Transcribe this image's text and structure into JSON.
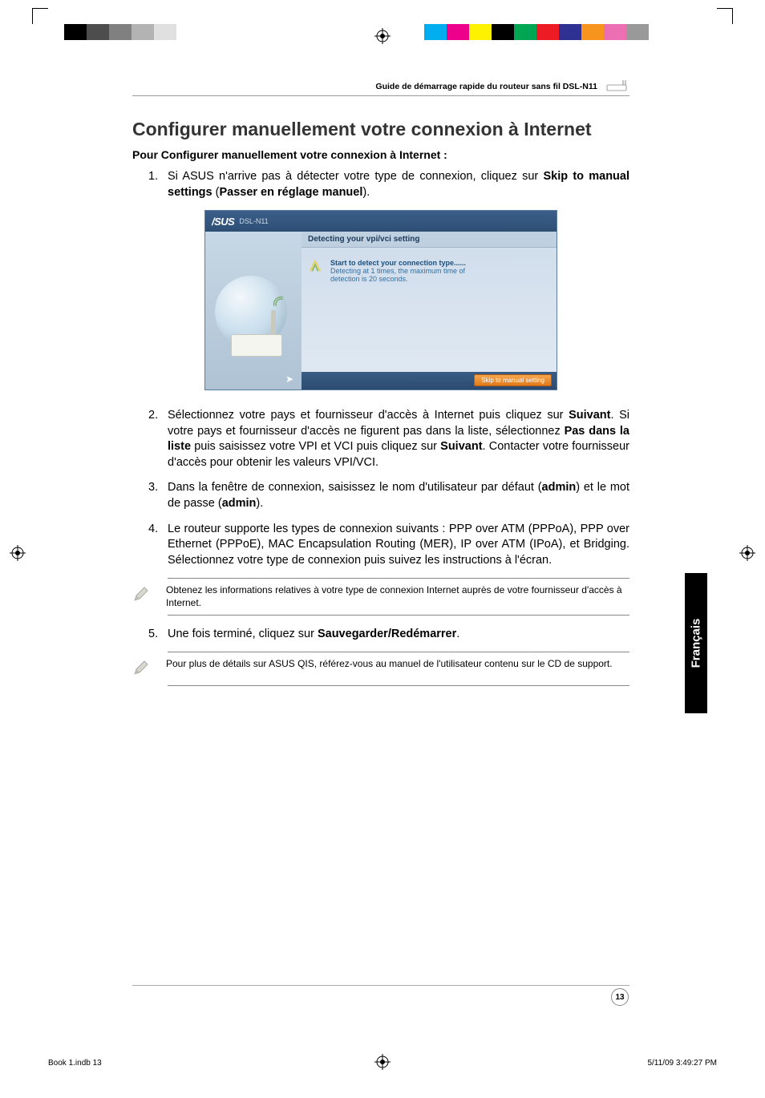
{
  "header": {
    "guide_title": "Guide de démarrage rapide du routeur sans fil DSL-N11"
  },
  "title": "Configurer manuellement votre connexion à Internet",
  "subtitle": "Pour Configurer manuellement votre connexion à Internet :",
  "steps": {
    "s1": {
      "num": "1.",
      "pre": "Si ASUS n'arrive pas à détecter votre type de connexion, cliquez sur ",
      "bold1": "Skip to manual settings",
      "mid1": " (",
      "bold2": "Passer en réglage manuel",
      "post": ")."
    },
    "s2": {
      "num": "2.",
      "pre": "Sélectionnez votre pays et fournisseur d'accès à Internet puis cliquez sur ",
      "bold1": "Suivant",
      "mid1": ". Si votre pays et fournisseur d'accès ne figurent pas dans la liste, sélectionnez ",
      "bold2": "Pas dans la liste",
      "mid2": " puis saisissez votre VPI et VCI puis cliquez sur ",
      "bold3": "Suivant",
      "post": ". Contacter votre fournisseur d'accès pour obtenir les valeurs VPI/VCI."
    },
    "s3": {
      "num": "3.",
      "pre": "Dans la fenêtre de connexion, saisissez le nom d'utilisateur par défaut (",
      "bold1": "admin",
      "mid1": ") et le mot de passe (",
      "bold2": "admin",
      "post": ")."
    },
    "s4": {
      "num": "4.",
      "text": "Le routeur supporte les types de connexion suivants : PPP over ATM (PPPoA), PPP over Ethernet (PPPoE), MAC Encapsulation Routing (MER), IP over ATM (IPoA), et Bridging. Sélectionnez votre type de connexion puis suivez les instructions à l'écran."
    },
    "s5": {
      "num": "5.",
      "pre": "Une fois terminé, cliquez sur ",
      "bold1": "Sauvegarder/Redémarrer",
      "post": "."
    }
  },
  "notes": {
    "n1": "Obtenez les informations relatives à votre type de connexion Internet auprès de votre fournisseur d'accès à Internet.",
    "n2": "Pour plus de détails sur ASUS QIS, référez-vous au manuel de l'utilisateur contenu sur le CD de support."
  },
  "screenshot": {
    "logo": "/SUS",
    "model": "DSL-N11",
    "panel_title": "Detecting your vpi/vci setting",
    "msg_line1": "Start to detect your connection type......",
    "msg_line2": "Detecting at 1 times, the maximum time of",
    "msg_line3": "detection is 20 seconds.",
    "skip_btn": "Skip to manual setting"
  },
  "side_tab": "Français",
  "page_number": "13",
  "footer": {
    "left": "Book 1.indb   13",
    "right": "5/11/09   3:49:27 PM"
  },
  "colors": {
    "bar_left": [
      "#000000",
      "#4d4d4d",
      "#808080",
      "#b3b3b3",
      "#e0e0e0"
    ],
    "bar_right": [
      "#00aeef",
      "#ec008c",
      "#fff200",
      "#000000",
      "#00a651",
      "#ed1c24",
      "#2e3192",
      "#f7941d",
      "#ec6eb3",
      "#999999"
    ]
  }
}
